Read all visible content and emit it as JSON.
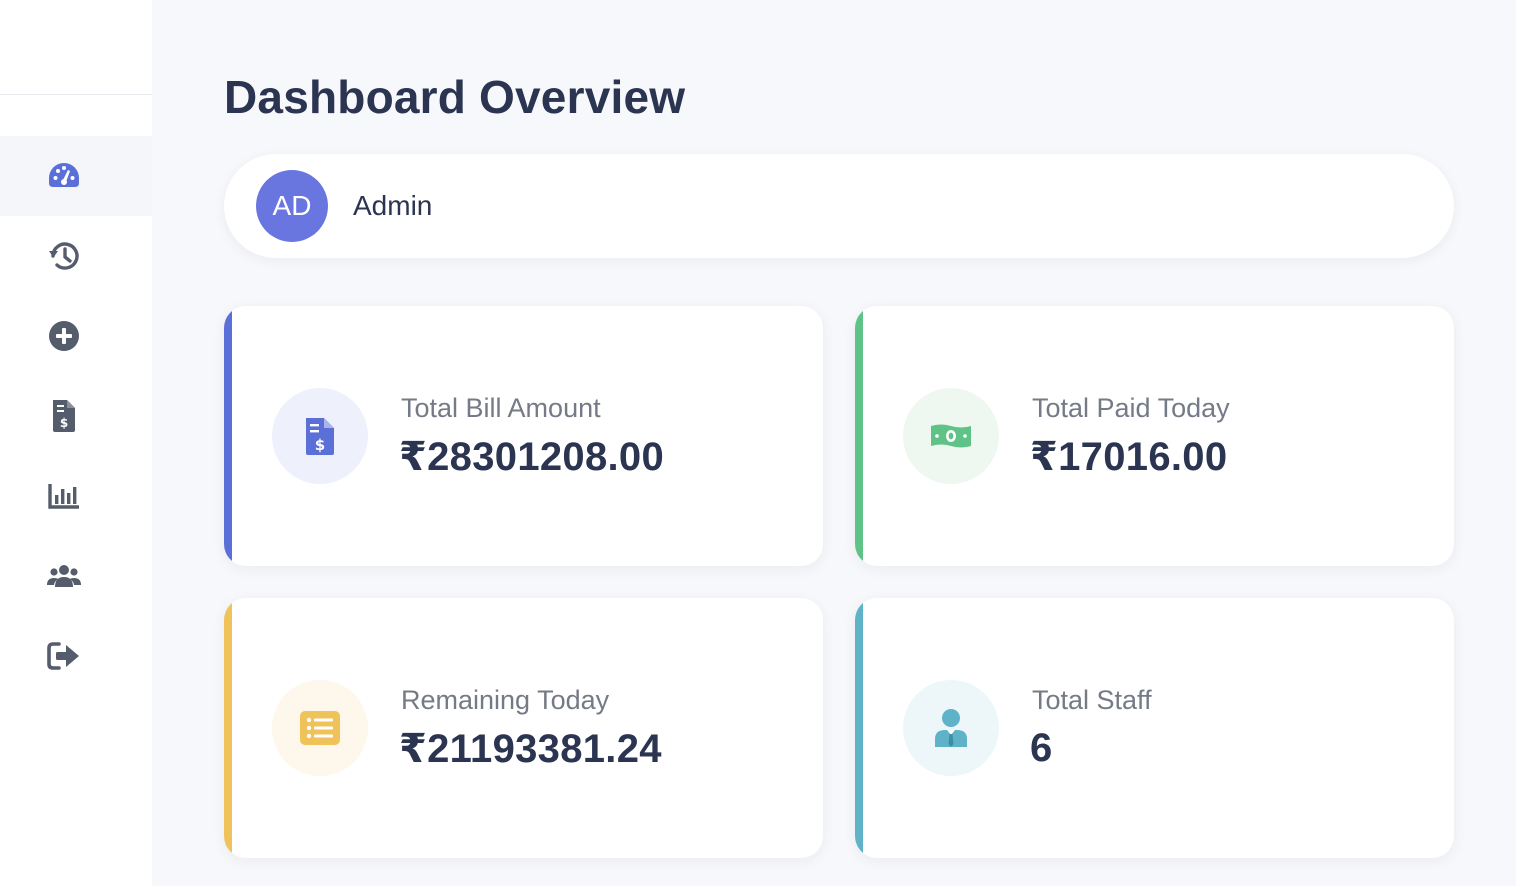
{
  "page": {
    "title": "Dashboard Overview"
  },
  "user": {
    "initials": "AD",
    "name": "Admin"
  },
  "sidebar": {
    "items": [
      {
        "icon": "dashboard-gauge-icon",
        "active": true
      },
      {
        "icon": "history-icon",
        "active": false
      },
      {
        "icon": "add-circle-icon",
        "active": false
      },
      {
        "icon": "invoice-icon",
        "active": false
      },
      {
        "icon": "bar-chart-icon",
        "active": false
      },
      {
        "icon": "users-icon",
        "active": false
      },
      {
        "icon": "logout-icon",
        "active": false
      }
    ]
  },
  "cards": [
    {
      "label": "Total Bill Amount",
      "value": "₹28301208.00",
      "accent": "#5b6fd8",
      "icon": "invoice-icon"
    },
    {
      "label": "Total Paid Today",
      "value": "₹17016.00",
      "accent": "#5fc387",
      "icon": "money-bill-icon"
    },
    {
      "label": "Remaining Today",
      "value": "₹21193381.24",
      "accent": "#f0c35a",
      "icon": "list-icon"
    },
    {
      "label": "Total Staff",
      "value": "6",
      "accent": "#5fb3c8",
      "icon": "staff-user-icon"
    }
  ],
  "colors": {
    "primary": "#5b6fd8",
    "sidebar_icon": "#555c6b",
    "text_dark": "#2b3450",
    "text_muted": "#747a86",
    "background": "#f6f8fb"
  }
}
